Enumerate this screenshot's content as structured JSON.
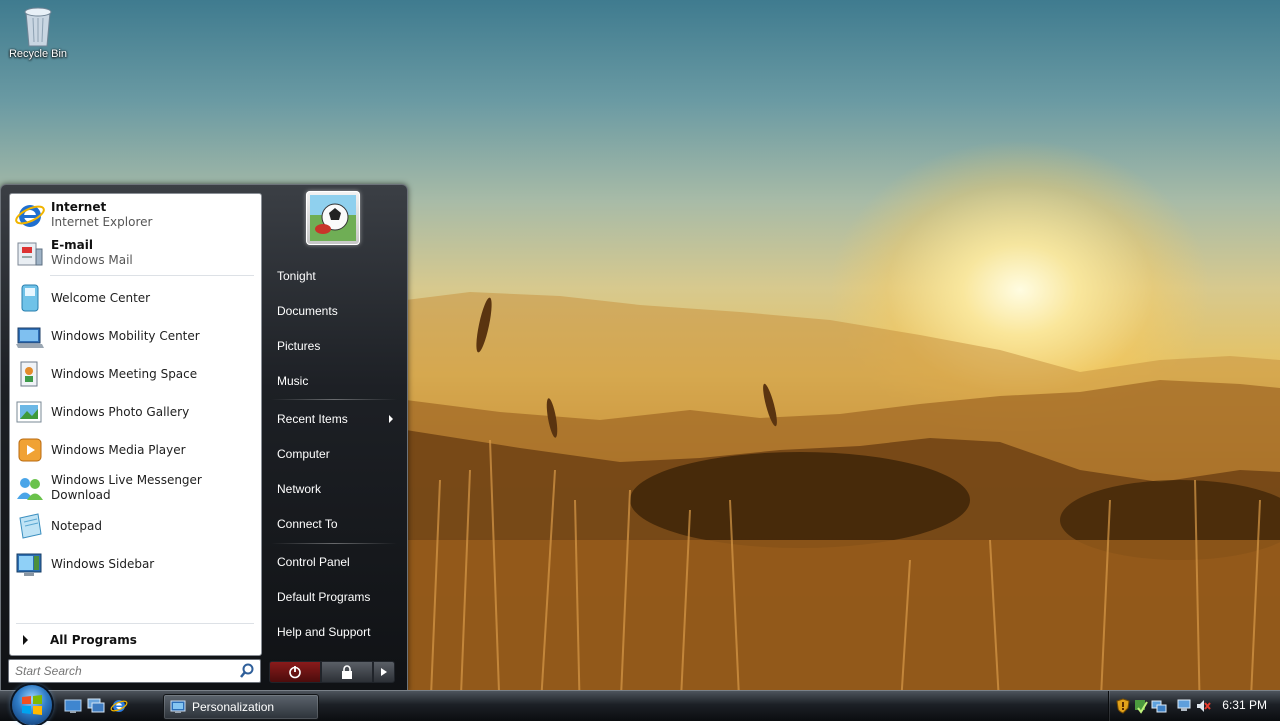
{
  "desktop": {
    "recycle_bin_label": "Recycle Bin"
  },
  "start_menu": {
    "pinned": [
      {
        "title": "Internet",
        "subtitle": "Internet Explorer",
        "icon": "internet-explorer-icon"
      },
      {
        "title": "E-mail",
        "subtitle": "Windows Mail",
        "icon": "windows-mail-icon"
      }
    ],
    "recent": [
      {
        "label": "Welcome Center",
        "icon": "welcome-center-icon"
      },
      {
        "label": "Windows Mobility Center",
        "icon": "mobility-center-icon"
      },
      {
        "label": "Windows Meeting Space",
        "icon": "meeting-space-icon"
      },
      {
        "label": "Windows Photo Gallery",
        "icon": "photo-gallery-icon"
      },
      {
        "label": "Windows Media Player",
        "icon": "media-player-icon"
      },
      {
        "label": "Windows Live Messenger Download",
        "icon": "messenger-icon"
      },
      {
        "label": "Notepad",
        "icon": "notepad-icon"
      },
      {
        "label": "Windows Sidebar",
        "icon": "sidebar-icon"
      }
    ],
    "all_programs": "All Programs",
    "search_placeholder": "Start Search",
    "right": [
      {
        "label": "Tonight"
      },
      {
        "label": "Documents"
      },
      {
        "label": "Pictures"
      },
      {
        "label": "Music"
      },
      {
        "label": "Recent Items"
      },
      {
        "label": "Computer"
      },
      {
        "label": "Network"
      },
      {
        "label": "Connect To"
      },
      {
        "label": "Control Panel"
      },
      {
        "label": "Default Programs"
      },
      {
        "label": "Help and Support"
      }
    ]
  },
  "taskbar": {
    "quick_launch": [
      "show-desktop-icon",
      "switch-windows-icon",
      "internet-explorer-icon"
    ],
    "window_button": "Personalization",
    "tray_icons": [
      "security-shield-icon",
      "update-icon",
      "network-icon",
      "display-icon",
      "volume-muted-icon"
    ],
    "clock": "6:31 PM"
  },
  "colors": {
    "taskbar": "#1c2026",
    "start_menu_dark": "#1d2025",
    "power_button": "#8a1b1b",
    "start_orb": "#2e7bc6"
  }
}
